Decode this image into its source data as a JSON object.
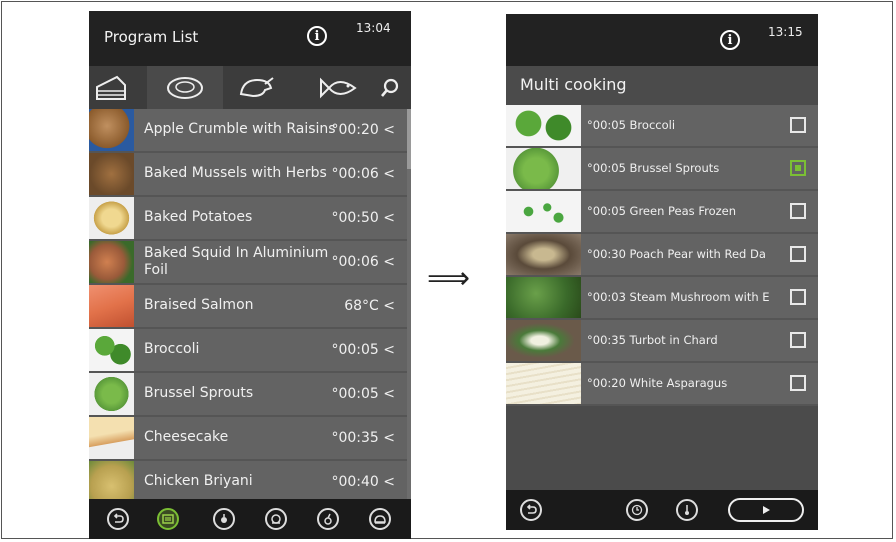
{
  "left_screen": {
    "title": "Program List",
    "time": "13:04",
    "categories": [
      "cake-icon",
      "meat-icon",
      "poultry-icon",
      "fish-icon",
      "search-icon"
    ],
    "items": [
      {
        "name": "Apple Crumble with Raisins",
        "time": "°00:20",
        "thumb": "#8a5a2b"
      },
      {
        "name": "Baked Mussels with Herbs",
        "time": "°00:06",
        "thumb": "#6b4a2a"
      },
      {
        "name": "Baked Potatoes",
        "time": "°00:50",
        "thumb": "#c8a24a"
      },
      {
        "name": "Baked Squid In Aluminium Foil",
        "time": "°00:06",
        "thumb": "#9a5a3a"
      },
      {
        "name": "Braised Salmon",
        "time": "68°C",
        "thumb": "#e2724a"
      },
      {
        "name": "Broccoli",
        "time": "°00:05",
        "thumb": "#3f8a2a"
      },
      {
        "name": "Brussel Sprouts",
        "time": "°00:05",
        "thumb": "#5a9a3a"
      },
      {
        "name": "Cheesecake",
        "time": "°00:35",
        "thumb": "#d8a060"
      },
      {
        "name": "Chicken Briyani",
        "time": "°00:40",
        "thumb": "#b8a050"
      }
    ],
    "bottom_icons": [
      "back-icon",
      "program-list-icon",
      "assisted-icon",
      "steam-icon",
      "temperature-icon",
      "favorite-icon"
    ]
  },
  "arrow": "⟹",
  "right_screen": {
    "title": "Multi cooking",
    "time": "13:15",
    "items": [
      {
        "name": "°00:05 Broccoli",
        "checked": false,
        "thumb": "#3f8a2a"
      },
      {
        "name": "°00:05 Brussel Sprouts",
        "checked": true,
        "thumb": "#5a9a3a"
      },
      {
        "name": "°00:05 Green Peas Frozen",
        "checked": false,
        "thumb": "#4aa640"
      },
      {
        "name": "°00:30 Poach Pear with Red Da",
        "checked": false,
        "thumb": "#5a4a3a"
      },
      {
        "name": "°00:03 Steam Mushroom with E",
        "checked": false,
        "thumb": "#3a6a2a"
      },
      {
        "name": "°00:35 Turbot in Chard",
        "checked": false,
        "thumb": "#4a7a3a"
      },
      {
        "name": "°00:20 White Asparagus",
        "checked": false,
        "thumb": "#e8e0c8"
      }
    ],
    "bottom_icons": [
      "back-icon",
      "timer-icon",
      "core-temp-icon",
      "start-icon"
    ]
  }
}
